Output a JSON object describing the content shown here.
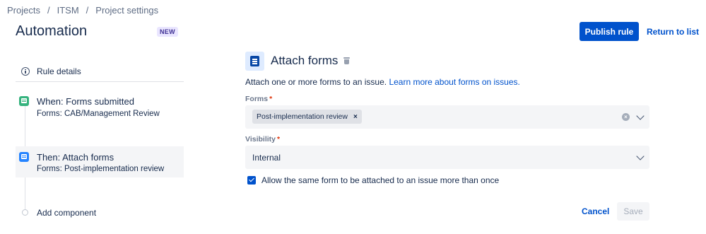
{
  "breadcrumb": [
    "Projects",
    "ITSM",
    "Project settings"
  ],
  "breadcrumb_separator": "/",
  "header": {
    "title": "Automation",
    "badge": "NEW",
    "publish_label": "Publish rule",
    "return_label": "Return to list"
  },
  "sidebar": {
    "rule_details": "Rule details",
    "items": [
      {
        "title": "When: Forms submitted",
        "subtitle": "Forms: CAB/Management Review",
        "icon": "form-icon",
        "color": "#36b37e"
      },
      {
        "title": "Then: Attach forms",
        "subtitle": "Forms: Post-implementation review",
        "icon": "form-icon",
        "color": "#2684ff",
        "selected": true
      }
    ],
    "add_component": "Add component"
  },
  "panel": {
    "title": "Attach forms",
    "description": "Attach one or more forms to an issue.",
    "learn_more": "Learn more about forms on issues.",
    "forms_label": "Forms",
    "required_mark": "*",
    "forms_selected": [
      "Post-implementation review"
    ],
    "tag_remove": "×",
    "clear_glyph": "×",
    "visibility_label": "Visibility",
    "visibility_value": "Internal",
    "allow_duplicate_label": "Allow the same form to be attached to an issue more than once",
    "allow_duplicate_checked": true,
    "cancel_label": "Cancel",
    "save_label": "Save"
  },
  "colors": {
    "primary": "#0052cc",
    "badge_bg": "#eae6ff",
    "badge_text": "#403294"
  }
}
